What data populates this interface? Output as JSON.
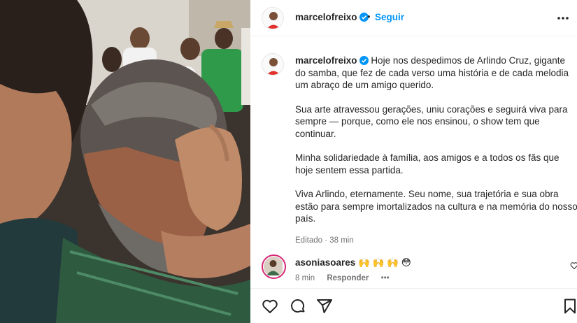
{
  "post": {
    "photo_alt": "",
    "author": {
      "username": "marcelofreixo",
      "verified": true,
      "follow_label": "Seguir",
      "separator": "•"
    },
    "caption": {
      "username": "marcelofreixo",
      "paragraphs": [
        "Hoje nos despedimos de Arlindo Cruz, gigante do samba, que fez de cada verso uma história e de cada melodia um abraço de um amigo querido.",
        "Sua arte atravessou gerações, uniu corações e seguirá viva para sempre — porque, como ele nos ensinou, o show tem que continuar.",
        "Minha solidariedade à família, aos amigos e a todos os fãs que hoje sentem essa partida.",
        "Viva Arlindo, eternamente. Seu nome, sua trajetória e sua obra estão para sempre imortalizados na cultura e na memória do nosso país."
      ],
      "meta": "Editado · 38 min"
    },
    "comment": {
      "username": "asoniasoares",
      "text": "🙌 🙌 🙌 😳",
      "time": "8 min",
      "reply_label": "Responder",
      "more_label": "•••"
    },
    "actions": {
      "icons": [
        "heart-icon",
        "comment-icon",
        "share-icon",
        "bookmark-icon"
      ]
    },
    "colors": {
      "accent": "#0095f6",
      "text": "#262626",
      "muted": "#737373",
      "avatar_red": "#e1312d"
    }
  }
}
